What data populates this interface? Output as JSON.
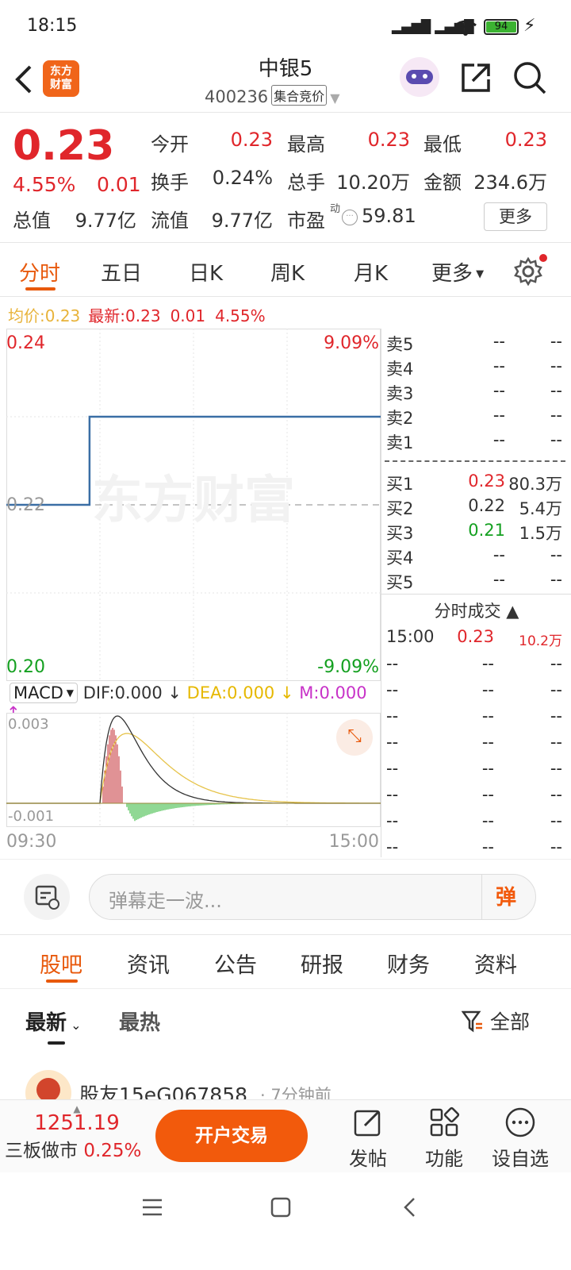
{
  "status": {
    "time": "18:15",
    "battery": "94"
  },
  "header": {
    "logo_line1": "东方",
    "logo_line2": "财富",
    "stock_name": "中银5",
    "stock_code": "400236",
    "stage_tag": "集合竞价"
  },
  "quote": {
    "price": "0.23",
    "change_pct": "4.55%",
    "change": "0.01",
    "fields": [
      {
        "label": "今开",
        "value": "0.23",
        "color": "red"
      },
      {
        "label": "最高",
        "value": "0.23",
        "color": "red"
      },
      {
        "label": "最低",
        "value": "0.23",
        "color": "red"
      },
      {
        "label": "换手",
        "value": "0.24%",
        "color": "dark"
      },
      {
        "label": "总手",
        "value": "10.20万",
        "color": "dark"
      },
      {
        "label": "金额",
        "value": "234.6万",
        "color": "dark"
      },
      {
        "label": "总值",
        "value": "9.77亿",
        "color": "dark"
      },
      {
        "label": "流值",
        "value": "9.77亿",
        "color": "dark"
      },
      {
        "label": "市盈",
        "value": "59.81",
        "color": "dark"
      }
    ],
    "pe_sup": "动",
    "more_label": "更多"
  },
  "period_tabs": [
    "分时",
    "五日",
    "日K",
    "周K",
    "月K",
    "更多"
  ],
  "avg_line": {
    "avg_label": "均价:",
    "avg": "0.23",
    "last_label": "最新:",
    "last": "0.23",
    "chg": "0.01",
    "pct": "4.55%"
  },
  "chart": {
    "y_top": "0.24",
    "y_mid": "0.22",
    "y_bot": "0.20",
    "pct_top": "9.09%",
    "pct_bot": "-9.09%",
    "watermark": "东方财富",
    "x_start": "09:30",
    "x_end": "15:00",
    "macd_label": "MACD",
    "dif": "DIF:0.000",
    "dea": "DEA:0.000",
    "m": "M:0.000",
    "macd_top": "0.003",
    "macd_bot": "-0.001"
  },
  "chart_data": {
    "type": "line",
    "title": "",
    "x": [
      "09:30",
      "10:30",
      "15:00"
    ],
    "series": [
      {
        "values": [
          0.22,
          0.23,
          0.23
        ]
      }
    ],
    "ylim": [
      0.2,
      0.24
    ],
    "reference": 0.22
  },
  "orderbook": {
    "asks": [
      {
        "name": "卖5",
        "price": "--",
        "qty": "--"
      },
      {
        "name": "卖4",
        "price": "--",
        "qty": "--"
      },
      {
        "name": "卖3",
        "price": "--",
        "qty": "--"
      },
      {
        "name": "卖2",
        "price": "--",
        "qty": "--"
      },
      {
        "name": "卖1",
        "price": "--",
        "qty": "--"
      }
    ],
    "bids": [
      {
        "name": "买1",
        "price": "0.23",
        "qty": "80.3万",
        "color": "red"
      },
      {
        "name": "买2",
        "price": "0.22",
        "qty": "5.4万",
        "color": "dark"
      },
      {
        "name": "买3",
        "price": "0.21",
        "qty": "1.5万",
        "color": "green"
      },
      {
        "name": "买4",
        "price": "--",
        "qty": "--",
        "color": "dark"
      },
      {
        "name": "买5",
        "price": "--",
        "qty": "--",
        "color": "dark"
      }
    ],
    "trades_label": "分时成交",
    "trades": [
      {
        "time": "15:00",
        "price": "0.23",
        "qty": "10.2万"
      }
    ],
    "empty": "--"
  },
  "comment": {
    "placeholder": "弹幕走一波...",
    "danmu": "弹"
  },
  "section_tabs": [
    "股吧",
    "资讯",
    "公告",
    "研报",
    "财务",
    "资料"
  ],
  "filter": {
    "latest": "最新",
    "hot": "最热",
    "all": "全部"
  },
  "post": {
    "user": "股友15eG067858",
    "time": "7分钟前"
  },
  "bottom": {
    "index_value": "1251.19",
    "index_name": "三板做市",
    "index_pct": "0.25%",
    "open_btn": "开户交易",
    "post": "发帖",
    "func": "功能",
    "watch": "设自选"
  }
}
